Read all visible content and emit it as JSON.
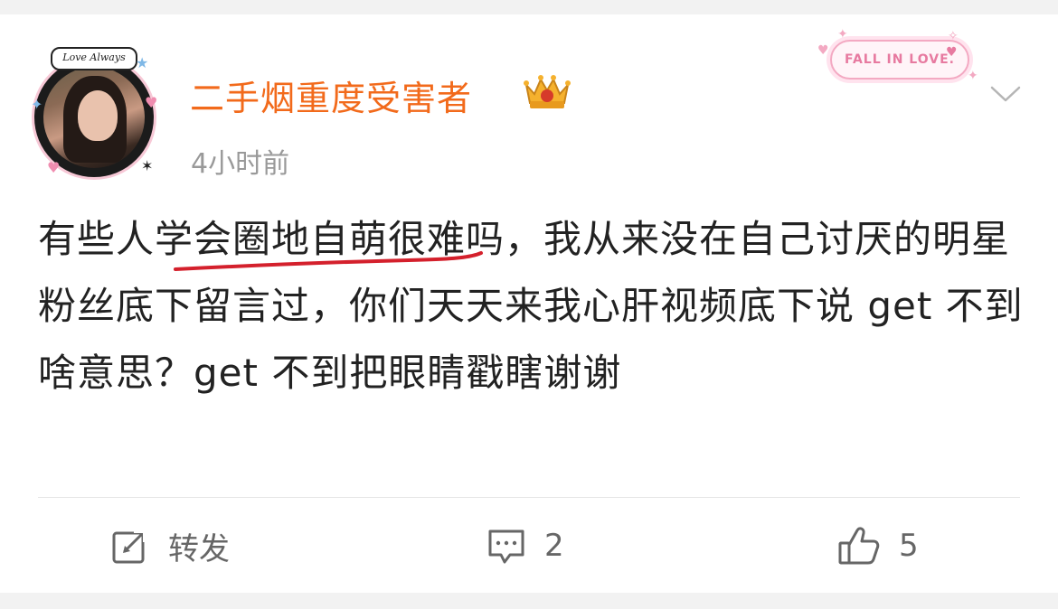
{
  "post": {
    "username": "二手烟重度受害者",
    "time": "4小时前",
    "avatar_banner": "Love Always",
    "badge_text": "FALL IN LOVE.",
    "text_before": "有些",
    "text_underlined": "人学会圈地自萌",
    "text_after": "很难吗，我从来没在自己讨厌的明星粉丝底下留言过，你们天天来我心肝视频底下说 get 不到啥意思？get 不到把眼睛戳瞎谢谢"
  },
  "actions": {
    "repost_label": "转发",
    "comment_count": "2",
    "like_count": "5"
  },
  "icons": {
    "avatar": "avatar-photo",
    "crown": "crown-badge-icon",
    "chevron": "chevron-down-icon",
    "repost": "repost-icon",
    "comment": "comment-icon",
    "like": "thumbs-up-icon"
  },
  "colors": {
    "username": "#f26a1b",
    "underline": "#d4202c",
    "muted": "#999999",
    "badge_pink": "#e77aa0"
  }
}
